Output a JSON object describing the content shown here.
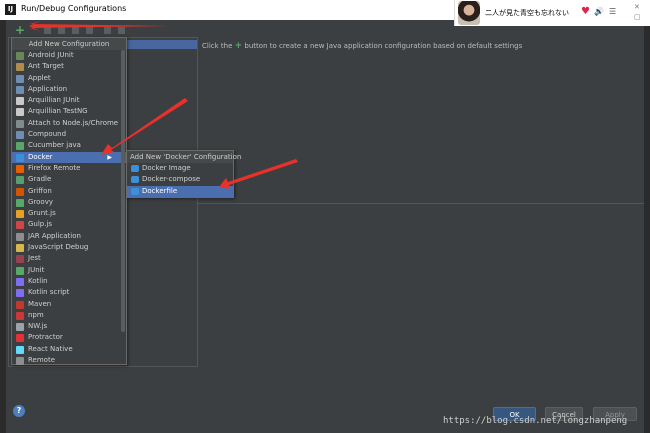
{
  "window": {
    "title": "Run/Debug Configurations",
    "app_icon": "IJ"
  },
  "music": {
    "song": "二人が見た青空も忘れない"
  },
  "hint": {
    "before": "Click the",
    "after": "button to create a new Java application configuration based on default settings"
  },
  "popup": {
    "header": "Add New Configuration",
    "items": [
      {
        "label": "Android JUnit",
        "icon": "android-junit-icon",
        "color": "#6a8759"
      },
      {
        "label": "Ant Target",
        "icon": "ant-icon",
        "color": "#b08c4a"
      },
      {
        "label": "Applet",
        "icon": "applet-icon",
        "color": "#6e8fb3"
      },
      {
        "label": "Application",
        "icon": "application-icon",
        "color": "#6e8fb3"
      },
      {
        "label": "Arquillian JUnit",
        "icon": "arquillian-icon",
        "color": "#c9c9c9"
      },
      {
        "label": "Arquillian TestNG",
        "icon": "arquillian-icon",
        "color": "#c9c9c9"
      },
      {
        "label": "Attach to Node.js/Chrome",
        "icon": "attach-icon",
        "color": "#7f8c8d"
      },
      {
        "label": "Compound",
        "icon": "compound-icon",
        "color": "#6e8fb3"
      },
      {
        "label": "Cucumber java",
        "icon": "cucumber-icon",
        "color": "#59a869"
      },
      {
        "label": "Docker",
        "icon": "docker-icon",
        "color": "#3d8fd8"
      },
      {
        "label": "Firefox Remote",
        "icon": "firefox-icon",
        "color": "#e66000"
      },
      {
        "label": "Gradle",
        "icon": "gradle-icon",
        "color": "#5a9e6f"
      },
      {
        "label": "Griffon",
        "icon": "griffon-icon",
        "color": "#d35400"
      },
      {
        "label": "Groovy",
        "icon": "groovy-icon",
        "color": "#59a869"
      },
      {
        "label": "Grunt.js",
        "icon": "grunt-icon",
        "color": "#e4a125"
      },
      {
        "label": "Gulp.js",
        "icon": "gulp-icon",
        "color": "#cf4647"
      },
      {
        "label": "JAR Application",
        "icon": "jar-icon",
        "color": "#8e8e8e"
      },
      {
        "label": "JavaScript Debug",
        "icon": "js-debug-icon",
        "color": "#d4b84a"
      },
      {
        "label": "Jest",
        "icon": "jest-icon",
        "color": "#99424f"
      },
      {
        "label": "JUnit",
        "icon": "junit-icon",
        "color": "#59a869"
      },
      {
        "label": "Kotlin",
        "icon": "kotlin-icon",
        "color": "#7f6df2"
      },
      {
        "label": "Kotlin script",
        "icon": "kotlin-script-icon",
        "color": "#7f6df2"
      },
      {
        "label": "Maven",
        "icon": "maven-icon",
        "color": "#c0392b"
      },
      {
        "label": "npm",
        "icon": "npm-icon",
        "color": "#cb3837"
      },
      {
        "label": "NW.js",
        "icon": "nwjs-icon",
        "color": "#9aa3a8"
      },
      {
        "label": "Protractor",
        "icon": "protractor-icon",
        "color": "#e23237"
      },
      {
        "label": "React Native",
        "icon": "react-icon",
        "color": "#61dafb"
      },
      {
        "label": "Remote",
        "icon": "remote-icon",
        "color": "#8e8e8e"
      }
    ],
    "selected_index": 9
  },
  "submenu": {
    "header": "Add New 'Docker' Configuration",
    "items": [
      {
        "label": "Docker Image"
      },
      {
        "label": "Docker-compose"
      },
      {
        "label": "Dockerfile"
      }
    ],
    "selected_index": 2
  },
  "buttons": {
    "ok": "OK",
    "cancel": "Cancel",
    "apply": "Apply"
  },
  "watermark": "https://blog.csdn.net/longzhanpeng",
  "colors": {
    "background": "#3c3f41",
    "selection": "#4b6eaf",
    "accent_add": "#59a869",
    "annotation_arrow": "#e8312b"
  }
}
